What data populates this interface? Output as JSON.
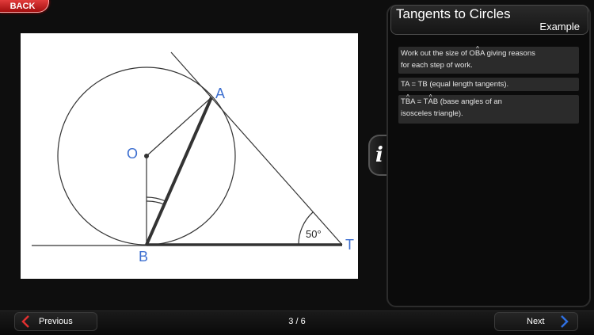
{
  "header": {
    "back_label": "BACK"
  },
  "diagram": {
    "labels": {
      "O": "O",
      "A": "A",
      "B": "B",
      "T": "T",
      "angle": "50°"
    }
  },
  "panel": {
    "title": "Tangents to Circles",
    "subtitle": "Example",
    "info_label": "i",
    "notes": [
      {
        "pre": "Work out the size of O",
        "hat": "B",
        "post": "A giving reasons",
        "line2": "for each step of work."
      },
      {
        "text": "TA = TB (equal length tangents)."
      },
      {
        "a_pre": "T",
        "a_hat": "B",
        "a_post": "A = T",
        "b_hat": "A",
        "b_post": "B (base angles of an",
        "line2": "isosceles triangle)."
      }
    ]
  },
  "footer": {
    "previous_label": "Previous",
    "next_label": "Next",
    "page_indicator": "3 / 6"
  },
  "colors": {
    "label_blue": "#3d6fd0",
    "back_red": "#c41a1a",
    "arrow_blue": "#2f6fe0"
  }
}
